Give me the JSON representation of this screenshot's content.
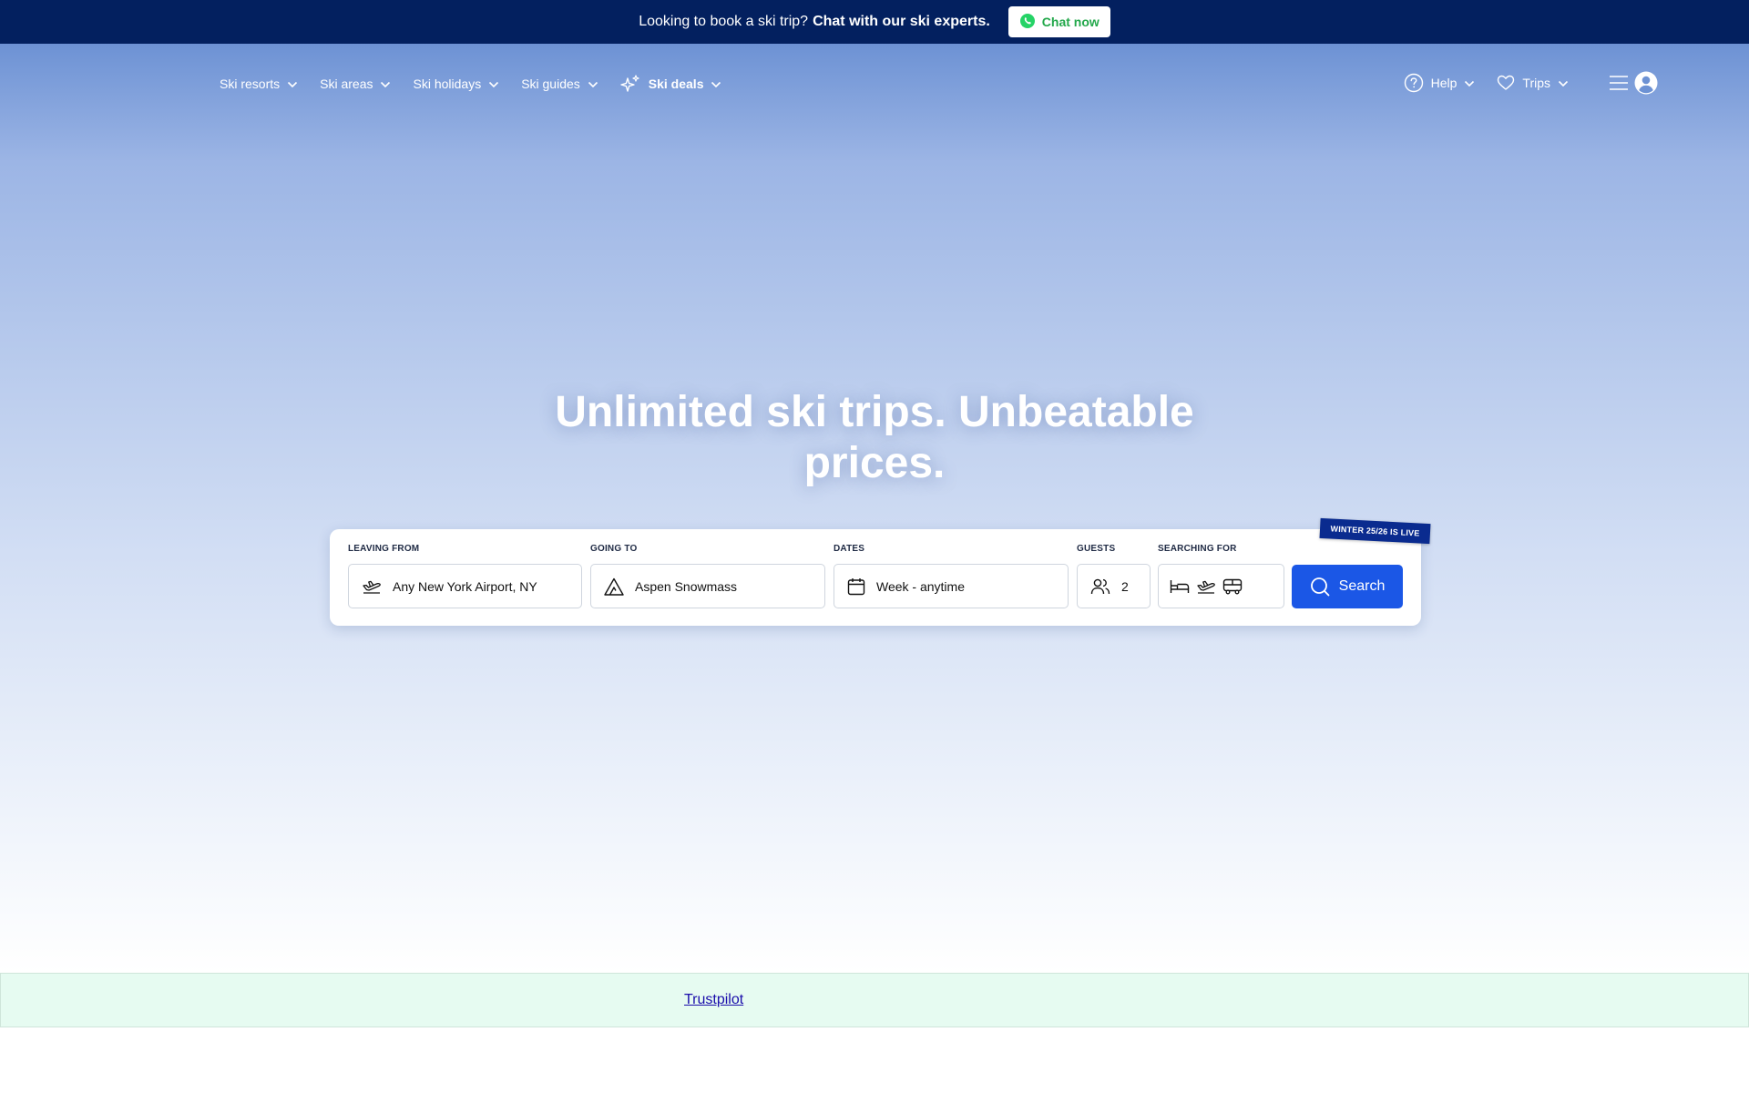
{
  "banner": {
    "text": "Looking to book a ski trip?",
    "bold_text": "Chat with our ski experts.",
    "chat_button": "Chat now",
    "chat_icon": "whatsapp-icon",
    "chat_color": "#23a84b"
  },
  "nav": {
    "items": [
      {
        "label": "Ski resorts",
        "icon": "chevron-down-icon"
      },
      {
        "label": "Ski areas",
        "icon": "chevron-down-icon"
      },
      {
        "label": "Ski holidays",
        "icon": "chevron-down-icon"
      },
      {
        "label": "Ski guides",
        "icon": "chevron-down-icon"
      },
      {
        "label": "Ski deals",
        "icon": "sparkle-icon"
      }
    ],
    "help": "Help",
    "trips": "Trips"
  },
  "hero": {
    "headline": "Unlimited ski trips. Unbeatable prices."
  },
  "search": {
    "badge": "WINTER 25/26 IS LIVE",
    "leaving_from": {
      "label": "LEAVING FROM",
      "value": "Any New York Airport, NY"
    },
    "going_to": {
      "label": "GOING TO",
      "value": "Aspen Snowmass"
    },
    "dates": {
      "label": "DATES",
      "value": "Week - anytime"
    },
    "guests": {
      "label": "GUESTS",
      "value": "2"
    },
    "searching_for": {
      "label": "SEARCHING FOR",
      "icons": [
        "bed-icon",
        "plane-icon",
        "bus-icon"
      ]
    },
    "button": "Search",
    "button_color": "#1b57e6"
  },
  "footer": {
    "trustpilot": "Trustpilot"
  }
}
